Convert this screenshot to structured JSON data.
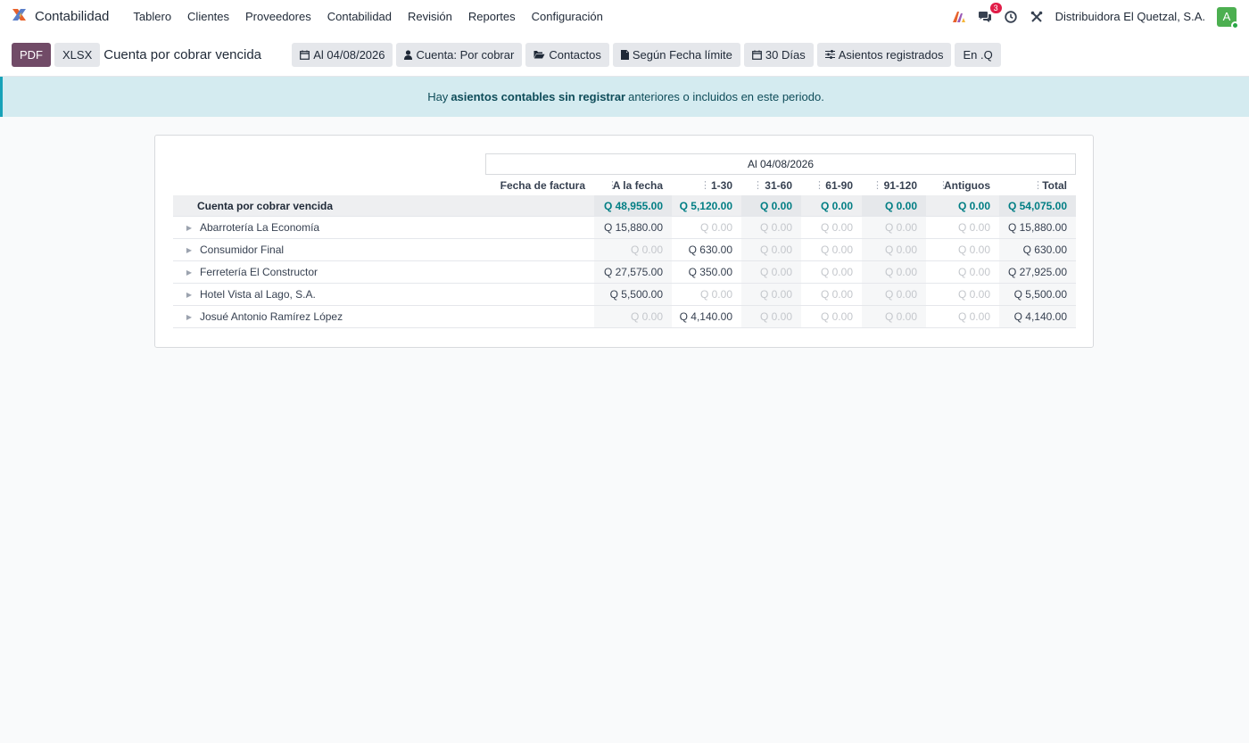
{
  "app": {
    "name": "Contabilidad"
  },
  "nav": {
    "items": [
      "Tablero",
      "Clientes",
      "Proveedores",
      "Contabilidad",
      "Revisión",
      "Reportes",
      "Configuración"
    ]
  },
  "navbar_right": {
    "messages_count": "3",
    "company": "Distribuidora El Quetzal, S.A.",
    "avatar_letter": "A"
  },
  "control": {
    "pdf": "PDF",
    "xlsx": "XLSX",
    "title": "Cuenta por cobrar vencida",
    "filters": [
      "Al 04/08/2026",
      "Cuenta: Por cobrar",
      "Contactos",
      "Según Fecha límite",
      "30 Días",
      "Asientos registrados",
      "En .Q"
    ]
  },
  "alert": {
    "pre": "Hay",
    "link": "asientos contables sin registrar",
    "post": "anteriores o incluidos en este periodo."
  },
  "report": {
    "group_header": "Al 04/08/2026",
    "columns": [
      "Fecha de factura",
      "A la fecha",
      "1-30",
      "31-60",
      "61-90",
      "91-120",
      "Antiguos",
      "Total"
    ],
    "total_row": {
      "label": "Cuenta por cobrar vencida",
      "values": [
        "",
        "Q 48,955.00",
        "Q 5,120.00",
        "Q 0.00",
        "Q 0.00",
        "Q 0.00",
        "Q 0.00",
        "Q 54,075.00"
      ]
    },
    "rows": [
      {
        "label": "Abarrotería La Economía",
        "values": [
          "",
          "Q 15,880.00",
          "Q 0.00",
          "Q 0.00",
          "Q 0.00",
          "Q 0.00",
          "Q 0.00",
          "Q 15,880.00"
        ]
      },
      {
        "label": "Consumidor Final",
        "values": [
          "",
          "Q 0.00",
          "Q 630.00",
          "Q 0.00",
          "Q 0.00",
          "Q 0.00",
          "Q 0.00",
          "Q 630.00"
        ]
      },
      {
        "label": "Ferretería El Constructor",
        "values": [
          "",
          "Q 27,575.00",
          "Q 350.00",
          "Q 0.00",
          "Q 0.00",
          "Q 0.00",
          "Q 0.00",
          "Q 27,925.00"
        ]
      },
      {
        "label": "Hotel Vista al Lago, S.A.",
        "values": [
          "",
          "Q 5,500.00",
          "Q 0.00",
          "Q 0.00",
          "Q 0.00",
          "Q 0.00",
          "Q 0.00",
          "Q 5,500.00"
        ]
      },
      {
        "label": "Josué Antonio Ramírez López",
        "values": [
          "",
          "Q 0.00",
          "Q 4,140.00",
          "Q 0.00",
          "Q 0.00",
          "Q 0.00",
          "Q 0.00",
          "Q 4,140.00"
        ]
      }
    ]
  }
}
